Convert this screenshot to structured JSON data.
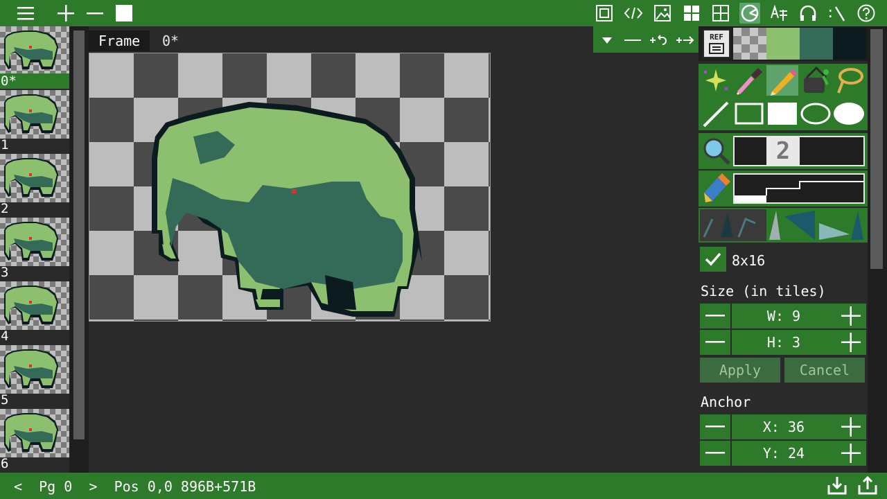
{
  "toolbar": {
    "left_icons": [
      "menu-icon",
      "plus-icon",
      "minus-icon",
      "square-icon"
    ],
    "right_icons": [
      "frame-icon",
      "code-icon",
      "image-icon",
      "tiles-icon",
      "grid-icon",
      "palette-icon",
      "text-icon",
      "headphones-icon",
      "script-icon",
      "help-icon"
    ],
    "active_icon": "palette-icon"
  },
  "frames": {
    "items": [
      "0*",
      "1",
      "2",
      "3",
      "4",
      "5",
      "6"
    ],
    "selected": "0*"
  },
  "canvas_header": {
    "tab_label": "Frame",
    "frame_name": "0*",
    "tool_icons": [
      "dropdown-icon",
      "minus-icon",
      "rotate-icon",
      "shift-icon"
    ]
  },
  "palette": {
    "ref_label": "REF",
    "colors": [
      "transparent",
      "#8cc06f",
      "#336b58",
      "#0c1b1f"
    ]
  },
  "tools": {
    "row1": [
      "magic-wand-icon",
      "eyedropper-icon",
      "pencil-icon",
      "bucket-icon",
      "lasso-icon"
    ],
    "row2": [
      "line-icon",
      "rect-icon",
      "filled-rect-icon",
      "ellipse-icon",
      "filled-ellipse-icon"
    ],
    "active": "pencil-icon",
    "zoom_value": "2"
  },
  "tile_mode": {
    "checked": true,
    "label": "8x16"
  },
  "size": {
    "title": "Size (in tiles)",
    "w_label": "W:",
    "w_value": "9",
    "h_label": "H:",
    "h_value": "3",
    "apply_label": "Apply",
    "cancel_label": "Cancel"
  },
  "anchor": {
    "title": "Anchor",
    "x_label": "X:",
    "x_value": "36",
    "y_label": "Y:",
    "y_value": "24"
  },
  "status": {
    "prev": "<",
    "page_label": "Pg",
    "page": "0",
    "next": ">",
    "pos_label": "Pos",
    "pos": "0,0",
    "size": "896B+571B",
    "right_icons": [
      "import-icon",
      "export-icon"
    ]
  },
  "colors": {
    "accent": "#2d7a2a",
    "light_green": "#8cc06f",
    "mid_green": "#336b58",
    "dark": "#0c1b1f"
  }
}
